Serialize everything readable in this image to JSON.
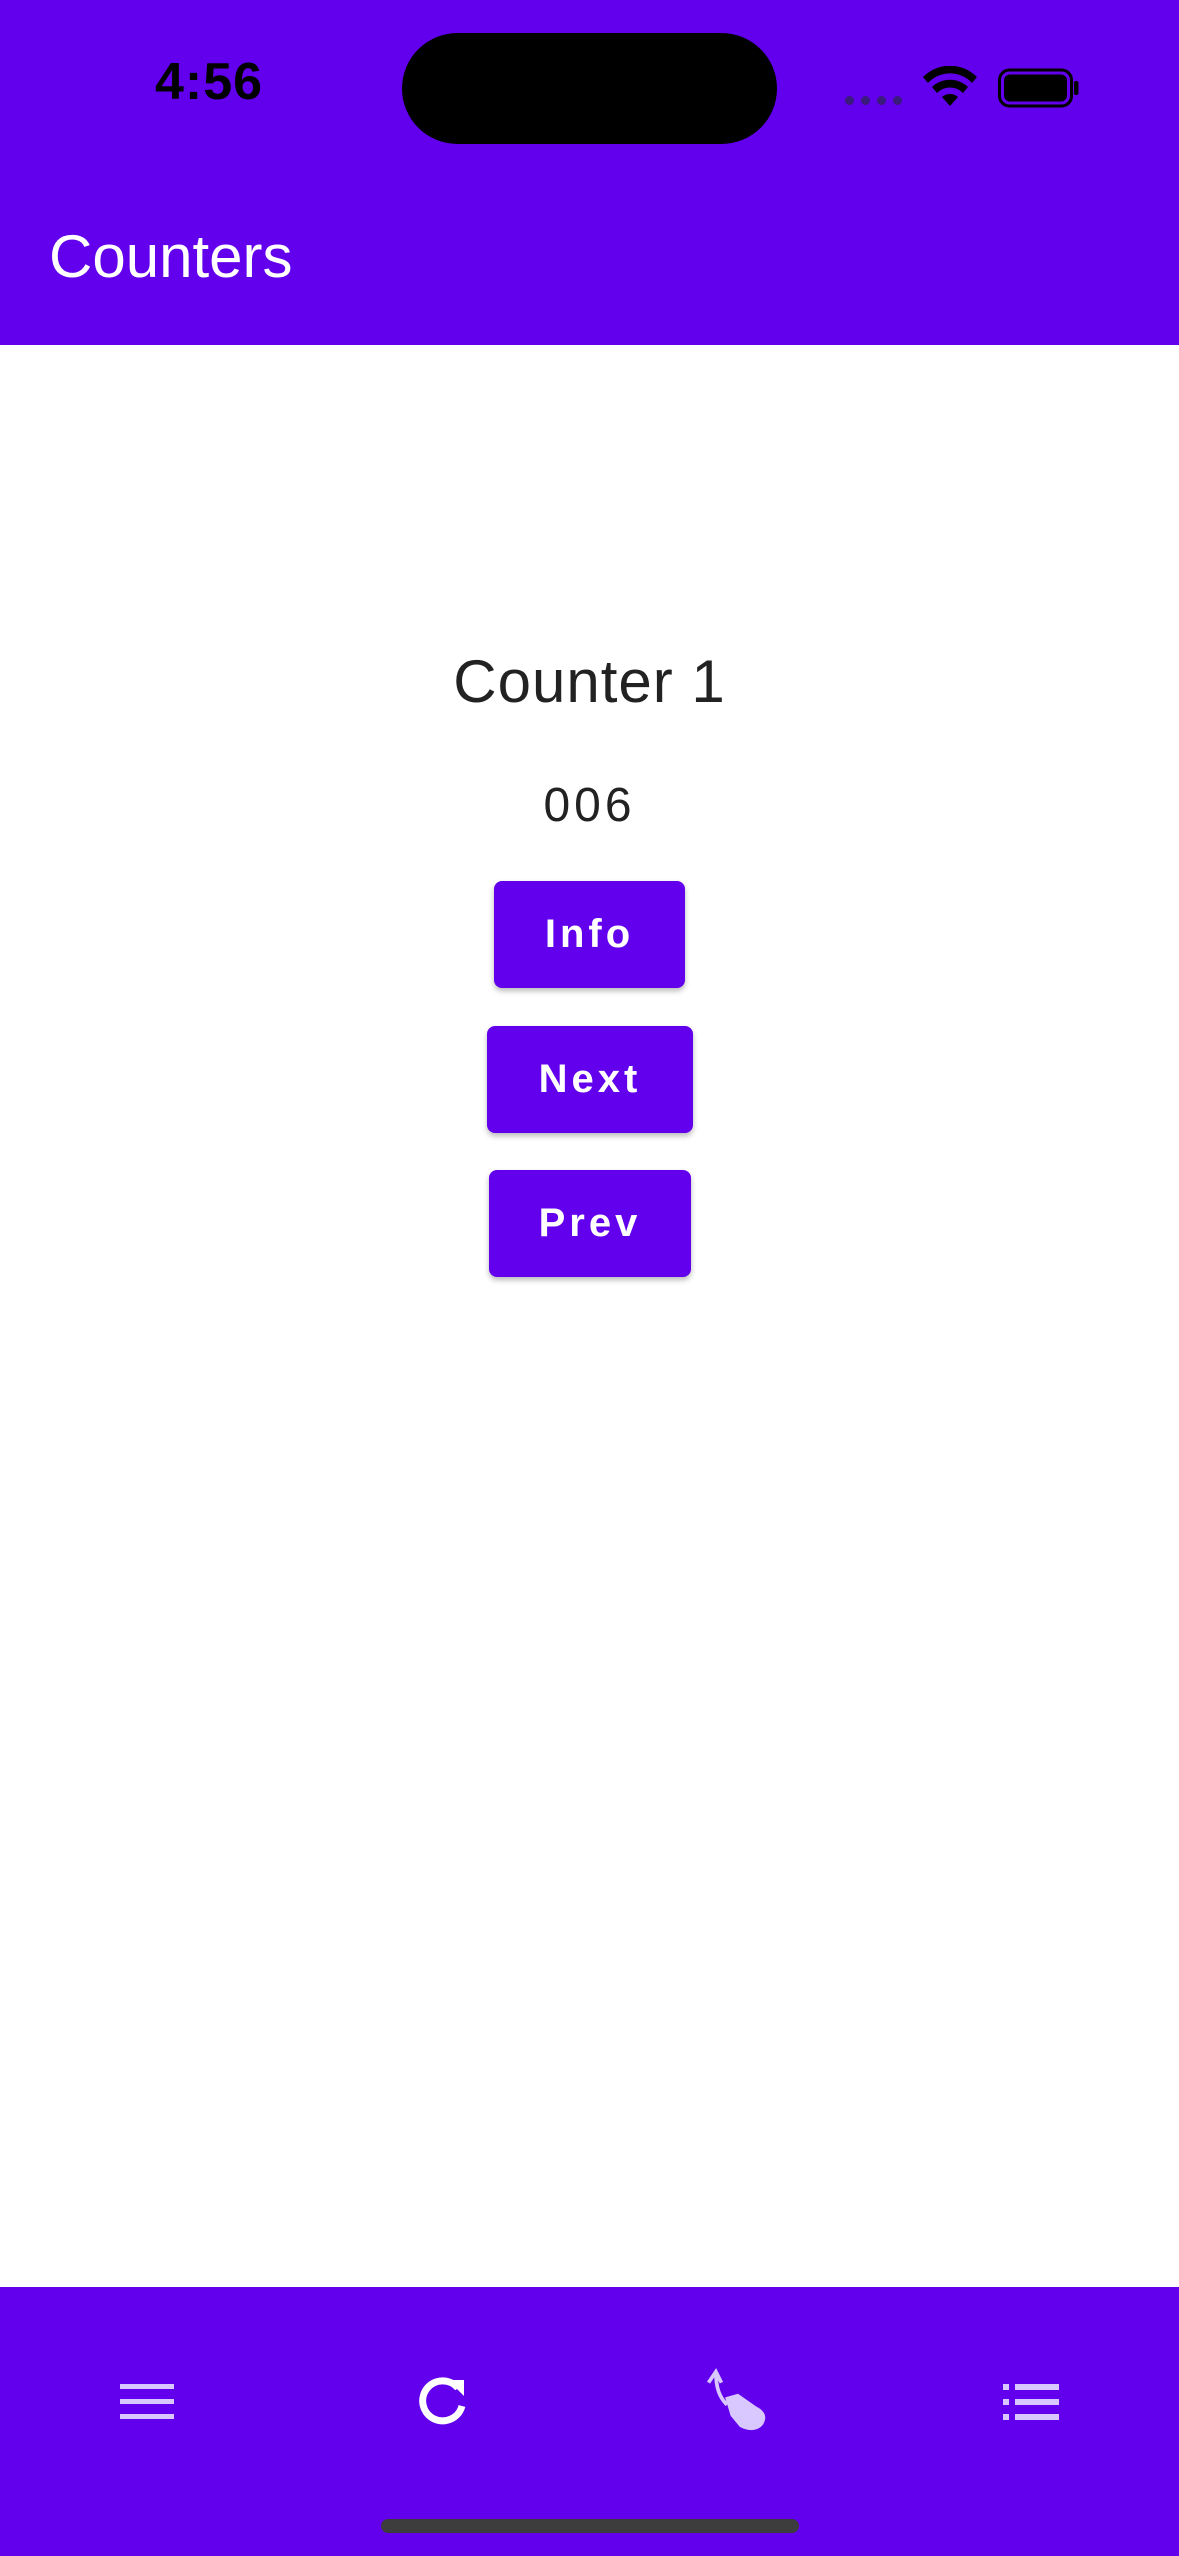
{
  "status_bar": {
    "time": "4:56"
  },
  "app_bar": {
    "title": "Counters"
  },
  "counter": {
    "title": "Counter 1",
    "value": "006"
  },
  "buttons": {
    "info": "Info",
    "next": "Next",
    "prev": "Prev"
  },
  "bottom_nav": {
    "items": [
      {
        "icon": "menu-icon"
      },
      {
        "icon": "refresh-icon"
      },
      {
        "icon": "swipe-gesture-icon"
      },
      {
        "icon": "list-icon"
      }
    ]
  },
  "colors": {
    "primary": "#6200ee",
    "background": "#ffffff",
    "text": "#222222",
    "nav_icon": "#d9c7ff"
  }
}
